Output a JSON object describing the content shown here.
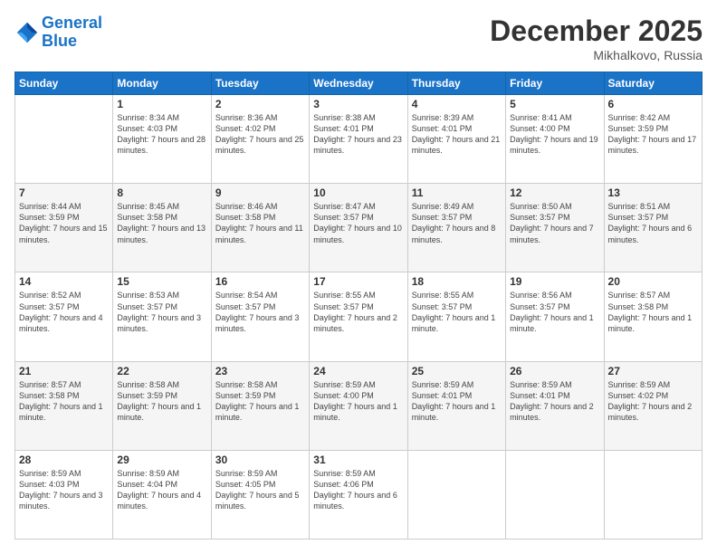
{
  "header": {
    "logo_line1": "General",
    "logo_line2": "Blue",
    "month": "December 2025",
    "location": "Mikhalkovo, Russia"
  },
  "weekdays": [
    "Sunday",
    "Monday",
    "Tuesday",
    "Wednesday",
    "Thursday",
    "Friday",
    "Saturday"
  ],
  "weeks": [
    [
      {
        "day": "",
        "text": ""
      },
      {
        "day": "1",
        "text": "Sunrise: 8:34 AM\nSunset: 4:03 PM\nDaylight: 7 hours\nand 28 minutes."
      },
      {
        "day": "2",
        "text": "Sunrise: 8:36 AM\nSunset: 4:02 PM\nDaylight: 7 hours\nand 25 minutes."
      },
      {
        "day": "3",
        "text": "Sunrise: 8:38 AM\nSunset: 4:01 PM\nDaylight: 7 hours\nand 23 minutes."
      },
      {
        "day": "4",
        "text": "Sunrise: 8:39 AM\nSunset: 4:01 PM\nDaylight: 7 hours\nand 21 minutes."
      },
      {
        "day": "5",
        "text": "Sunrise: 8:41 AM\nSunset: 4:00 PM\nDaylight: 7 hours\nand 19 minutes."
      },
      {
        "day": "6",
        "text": "Sunrise: 8:42 AM\nSunset: 3:59 PM\nDaylight: 7 hours\nand 17 minutes."
      }
    ],
    [
      {
        "day": "7",
        "text": "Sunrise: 8:44 AM\nSunset: 3:59 PM\nDaylight: 7 hours\nand 15 minutes."
      },
      {
        "day": "8",
        "text": "Sunrise: 8:45 AM\nSunset: 3:58 PM\nDaylight: 7 hours\nand 13 minutes."
      },
      {
        "day": "9",
        "text": "Sunrise: 8:46 AM\nSunset: 3:58 PM\nDaylight: 7 hours\nand 11 minutes."
      },
      {
        "day": "10",
        "text": "Sunrise: 8:47 AM\nSunset: 3:57 PM\nDaylight: 7 hours\nand 10 minutes."
      },
      {
        "day": "11",
        "text": "Sunrise: 8:49 AM\nSunset: 3:57 PM\nDaylight: 7 hours\nand 8 minutes."
      },
      {
        "day": "12",
        "text": "Sunrise: 8:50 AM\nSunset: 3:57 PM\nDaylight: 7 hours\nand 7 minutes."
      },
      {
        "day": "13",
        "text": "Sunrise: 8:51 AM\nSunset: 3:57 PM\nDaylight: 7 hours\nand 6 minutes."
      }
    ],
    [
      {
        "day": "14",
        "text": "Sunrise: 8:52 AM\nSunset: 3:57 PM\nDaylight: 7 hours\nand 4 minutes."
      },
      {
        "day": "15",
        "text": "Sunrise: 8:53 AM\nSunset: 3:57 PM\nDaylight: 7 hours\nand 3 minutes."
      },
      {
        "day": "16",
        "text": "Sunrise: 8:54 AM\nSunset: 3:57 PM\nDaylight: 7 hours\nand 3 minutes."
      },
      {
        "day": "17",
        "text": "Sunrise: 8:55 AM\nSunset: 3:57 PM\nDaylight: 7 hours\nand 2 minutes."
      },
      {
        "day": "18",
        "text": "Sunrise: 8:55 AM\nSunset: 3:57 PM\nDaylight: 7 hours\nand 1 minute."
      },
      {
        "day": "19",
        "text": "Sunrise: 8:56 AM\nSunset: 3:57 PM\nDaylight: 7 hours\nand 1 minute."
      },
      {
        "day": "20",
        "text": "Sunrise: 8:57 AM\nSunset: 3:58 PM\nDaylight: 7 hours\nand 1 minute."
      }
    ],
    [
      {
        "day": "21",
        "text": "Sunrise: 8:57 AM\nSunset: 3:58 PM\nDaylight: 7 hours\nand 1 minute."
      },
      {
        "day": "22",
        "text": "Sunrise: 8:58 AM\nSunset: 3:59 PM\nDaylight: 7 hours\nand 1 minute."
      },
      {
        "day": "23",
        "text": "Sunrise: 8:58 AM\nSunset: 3:59 PM\nDaylight: 7 hours\nand 1 minute."
      },
      {
        "day": "24",
        "text": "Sunrise: 8:59 AM\nSunset: 4:00 PM\nDaylight: 7 hours\nand 1 minute."
      },
      {
        "day": "25",
        "text": "Sunrise: 8:59 AM\nSunset: 4:01 PM\nDaylight: 7 hours\nand 1 minute."
      },
      {
        "day": "26",
        "text": "Sunrise: 8:59 AM\nSunset: 4:01 PM\nDaylight: 7 hours\nand 2 minutes."
      },
      {
        "day": "27",
        "text": "Sunrise: 8:59 AM\nSunset: 4:02 PM\nDaylight: 7 hours\nand 2 minutes."
      }
    ],
    [
      {
        "day": "28",
        "text": "Sunrise: 8:59 AM\nSunset: 4:03 PM\nDaylight: 7 hours\nand 3 minutes."
      },
      {
        "day": "29",
        "text": "Sunrise: 8:59 AM\nSunset: 4:04 PM\nDaylight: 7 hours\nand 4 minutes."
      },
      {
        "day": "30",
        "text": "Sunrise: 8:59 AM\nSunset: 4:05 PM\nDaylight: 7 hours\nand 5 minutes."
      },
      {
        "day": "31",
        "text": "Sunrise: 8:59 AM\nSunset: 4:06 PM\nDaylight: 7 hours\nand 6 minutes."
      },
      {
        "day": "",
        "text": ""
      },
      {
        "day": "",
        "text": ""
      },
      {
        "day": "",
        "text": ""
      }
    ]
  ]
}
